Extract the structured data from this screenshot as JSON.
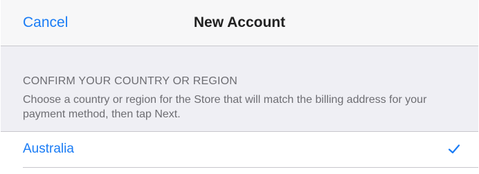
{
  "navbar": {
    "cancel_label": "Cancel",
    "title": "New Account"
  },
  "section": {
    "header": "CONFIRM YOUR COUNTRY OR REGION",
    "footer": "Choose a country or region for the Store that will match the billing address for your payment method, then tap Next."
  },
  "countries": [
    {
      "label": "Australia",
      "selected": true
    }
  ],
  "icons": {
    "selected_indicator": "checkmark-icon"
  },
  "colors": {
    "accent": "#1a7cf5",
    "background": "#efeff4",
    "navbar": "#f7f7f8",
    "secondary_text": "#6d6d72"
  }
}
